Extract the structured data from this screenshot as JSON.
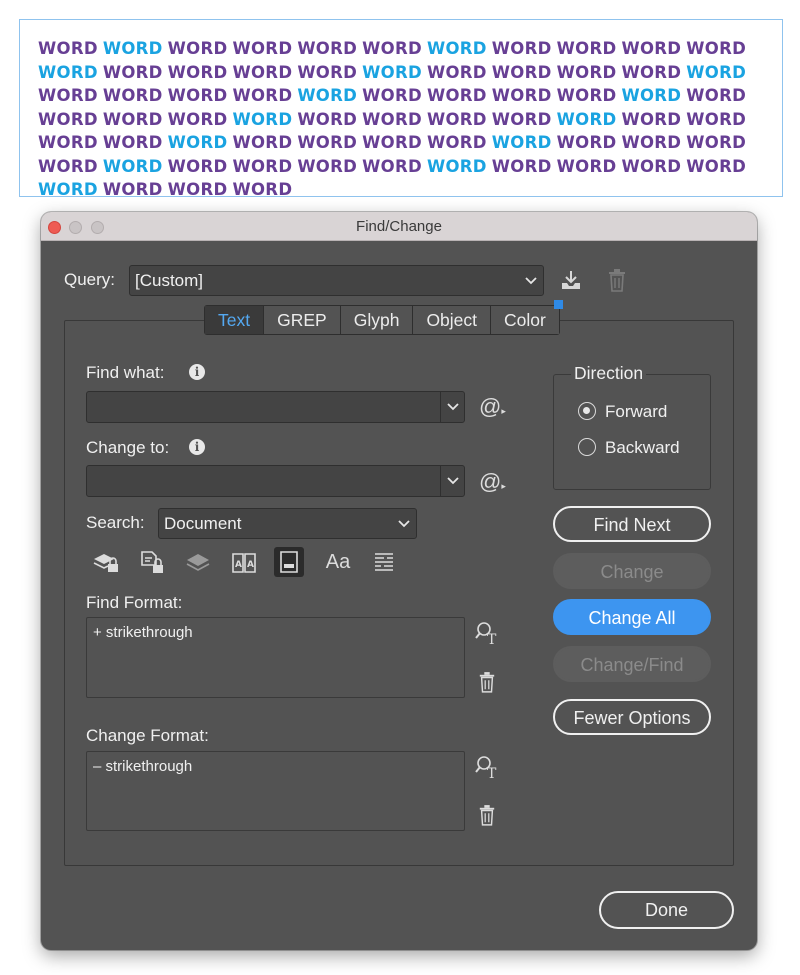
{
  "sample_text": {
    "words": [
      {
        "text": "WORD",
        "hl": false
      },
      {
        "text": "WORD",
        "hl": true
      },
      {
        "text": "WORD",
        "hl": false
      },
      {
        "text": "WORD",
        "hl": false
      },
      {
        "text": "WORD",
        "hl": false
      },
      {
        "text": "WORD",
        "hl": false
      },
      {
        "text": "WORD",
        "hl": true
      },
      {
        "text": "WORD",
        "hl": false
      },
      {
        "text": "WORD",
        "hl": false
      },
      {
        "text": "WORD",
        "hl": false
      },
      {
        "text": "WORD",
        "hl": false
      },
      {
        "text": "WORD",
        "hl": true
      },
      {
        "text": "WORD",
        "hl": false
      },
      {
        "text": "WORD",
        "hl": false
      },
      {
        "text": "WORD",
        "hl": false
      },
      {
        "text": "WORD",
        "hl": false
      },
      {
        "text": "WORD",
        "hl": true
      },
      {
        "text": "WORD",
        "hl": false
      },
      {
        "text": "WORD",
        "hl": false
      },
      {
        "text": "WORD",
        "hl": false
      },
      {
        "text": "WORD",
        "hl": false
      },
      {
        "text": "WORD",
        "hl": true
      },
      {
        "text": "WORD",
        "hl": false
      },
      {
        "text": "WORD",
        "hl": false
      },
      {
        "text": "WORD",
        "hl": false
      },
      {
        "text": "WORD",
        "hl": false
      },
      {
        "text": "WORD",
        "hl": true
      },
      {
        "text": "WORD",
        "hl": false
      },
      {
        "text": "WORD",
        "hl": false
      },
      {
        "text": "WORD",
        "hl": false
      },
      {
        "text": "WORD",
        "hl": false
      },
      {
        "text": "WORD",
        "hl": true
      },
      {
        "text": "WORD",
        "hl": false
      },
      {
        "text": "WORD",
        "hl": false
      },
      {
        "text": "WORD",
        "hl": false
      },
      {
        "text": "WORD",
        "hl": false
      },
      {
        "text": "WORD",
        "hl": true
      },
      {
        "text": "WORD",
        "hl": false
      },
      {
        "text": "WORD",
        "hl": false
      },
      {
        "text": "WORD",
        "hl": false
      },
      {
        "text": "WORD",
        "hl": false
      },
      {
        "text": "WORD",
        "hl": true
      },
      {
        "text": "WORD",
        "hl": false
      },
      {
        "text": "WORD",
        "hl": false
      },
      {
        "text": "WORD",
        "hl": false
      },
      {
        "text": "WORD",
        "hl": false
      },
      {
        "text": "WORD",
        "hl": true
      },
      {
        "text": "WORD",
        "hl": false
      },
      {
        "text": "WORD",
        "hl": false
      },
      {
        "text": "WORD",
        "hl": false
      },
      {
        "text": "WORD",
        "hl": false
      },
      {
        "text": "WORD",
        "hl": true
      },
      {
        "text": "WORD",
        "hl": false
      },
      {
        "text": "WORD",
        "hl": false
      },
      {
        "text": "WORD",
        "hl": false
      },
      {
        "text": "WORD",
        "hl": false
      },
      {
        "text": "WORD",
        "hl": true
      },
      {
        "text": "WORD",
        "hl": false
      },
      {
        "text": "WORD",
        "hl": false
      },
      {
        "text": "WORD",
        "hl": false
      },
      {
        "text": "WORD",
        "hl": false
      },
      {
        "text": "WORD",
        "hl": true
      },
      {
        "text": "WORD",
        "hl": false
      },
      {
        "text": "WORD",
        "hl": false
      },
      {
        "text": "WORD",
        "hl": false
      },
      {
        "text": "WORD",
        "hl": false
      },
      {
        "text": "WORD",
        "hl": true
      },
      {
        "text": "WORD",
        "hl": false
      },
      {
        "text": "WORD",
        "hl": false
      },
      {
        "text": "WORD",
        "hl": false
      }
    ],
    "colors": {
      "normal": "#673f94",
      "highlight": "#1aa3e1"
    }
  },
  "dialog": {
    "title": "Find/Change",
    "query_label": "Query:",
    "query_value": "[Custom]",
    "save_query_icon": "save-query-icon",
    "delete_query_icon": "trash-icon",
    "tabs": [
      {
        "label": "Text",
        "active": true
      },
      {
        "label": "GREP",
        "active": false
      },
      {
        "label": "Glyph",
        "active": false
      },
      {
        "label": "Object",
        "active": false
      },
      {
        "label": "Color",
        "active": false
      }
    ],
    "find_what_label": "Find what:",
    "find_what_value": "",
    "change_to_label": "Change to:",
    "change_to_value": "",
    "search_label": "Search:",
    "search_value": "Document",
    "find_format_label": "Find Format:",
    "find_format_value": "+ strikethrough",
    "change_format_label": "Change Format:",
    "change_format_value": "– strikethrough",
    "direction": {
      "title": "Direction",
      "options": [
        {
          "label": "Forward",
          "selected": true
        },
        {
          "label": "Backward",
          "selected": false
        }
      ]
    },
    "buttons": {
      "find_next": "Find Next",
      "change": "Change",
      "change_all": "Change All",
      "change_find": "Change/Find",
      "fewer_options": "Fewer Options",
      "done": "Done"
    },
    "search_options_icons": [
      "include-locked-layers-icon",
      "include-locked-stories-icon",
      "include-hidden-layers-icon",
      "include-master-pages-icon",
      "include-footnotes-icon",
      "case-sensitive-icon",
      "whole-word-icon"
    ],
    "accent_color": "#3d95f0"
  }
}
